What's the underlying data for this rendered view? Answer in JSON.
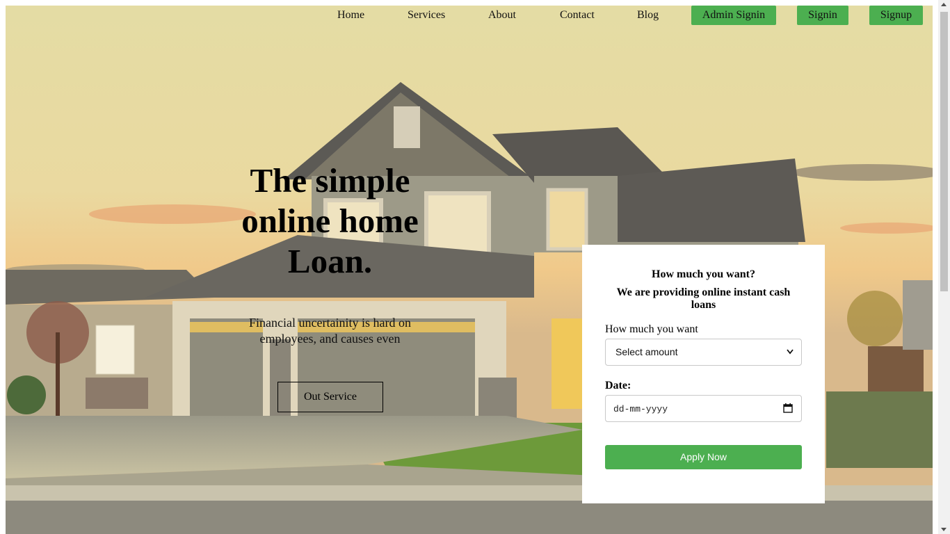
{
  "nav": {
    "links": [
      {
        "label": "Home"
      },
      {
        "label": "Services"
      },
      {
        "label": "About"
      },
      {
        "label": "Contact"
      },
      {
        "label": "Blog"
      }
    ],
    "buttons": [
      {
        "label": "Admin Signin"
      },
      {
        "label": "Signin"
      },
      {
        "label": "Signup"
      }
    ]
  },
  "hero": {
    "title": "The simple online home Loan.",
    "subtitle": "Financial uncertainity is hard on employees, and causes even",
    "button_label": "Out Service",
    "background_icon": "house-photo"
  },
  "form": {
    "heading": "How much you want?",
    "subheading": "We are providing online instant cash loans",
    "amount_label": "How much you want",
    "amount_selected": "Select amount",
    "date_label": "Date:",
    "date_placeholder": "dd-mm-yyyy",
    "submit_label": "Apply Now"
  },
  "colors": {
    "accent": "#4caf50",
    "card_bg": "#ffffff"
  }
}
